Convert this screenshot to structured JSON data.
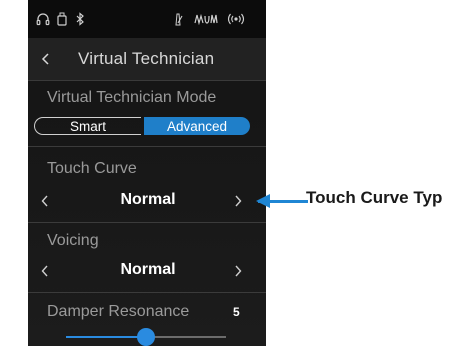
{
  "status_icons": [
    "headphones-icon",
    "usb-drive-icon",
    "bluetooth-icon",
    "metronome-icon",
    "recorder-icon",
    "wireless-icon"
  ],
  "header": {
    "title": "Virtual Technician"
  },
  "mode": {
    "label": "Virtual Technician Mode",
    "options": [
      "Smart",
      "Advanced"
    ],
    "selected": "Advanced"
  },
  "touch_curve": {
    "label": "Touch Curve",
    "value": "Normal"
  },
  "voicing": {
    "label": "Voicing",
    "value": "Normal"
  },
  "damper_resonance": {
    "label": "Damper Resonance",
    "value": "5",
    "level": 0.5
  },
  "callout": {
    "text": "Touch Curve Typ"
  },
  "colors": {
    "accent": "#1f7fc9",
    "callout": "#1f86d4"
  }
}
